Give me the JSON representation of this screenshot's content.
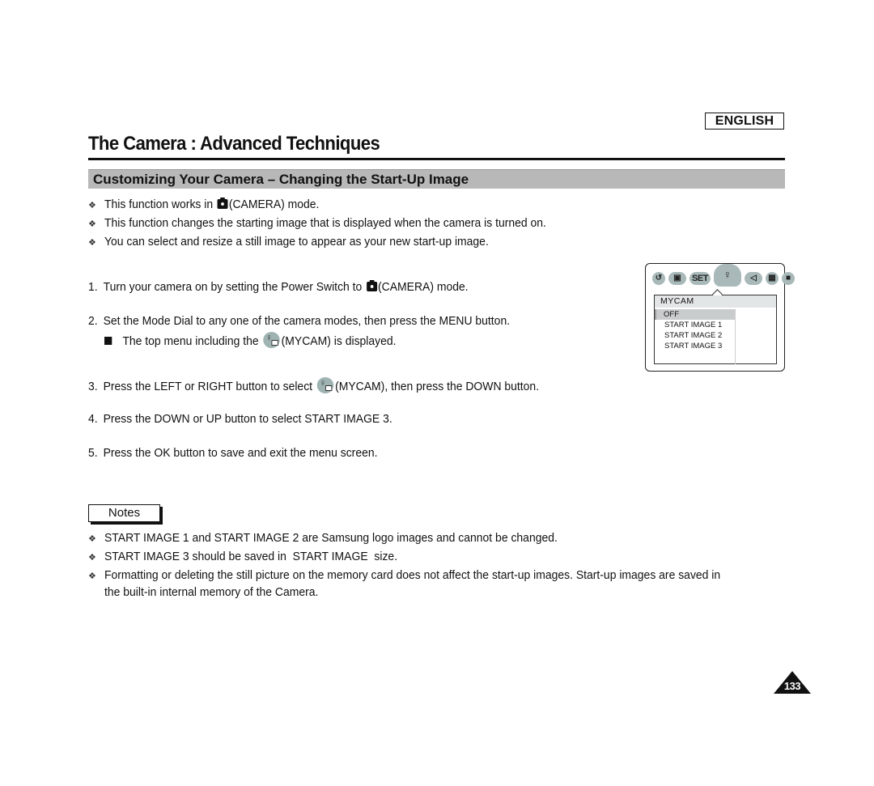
{
  "header": {
    "language": "ENGLISH",
    "title": "The Camera : Advanced Techniques",
    "section_title": "Customizing Your Camera – Changing the Start-Up Image"
  },
  "intro_bullets": [
    {
      "before": "This function works in ",
      "icon": "camera-icon",
      "after": "(CAMERA) mode."
    },
    {
      "text": "This function changes the starting image that is displayed when the camera is turned on."
    },
    {
      "text": "You can select and resize a still image to appear as your new start-up image."
    }
  ],
  "steps": [
    {
      "num": "1.",
      "before": "Turn your camera on by setting the Power Switch to ",
      "icon": "camera-icon",
      "after": "(CAMERA) mode."
    },
    {
      "num": "2.",
      "text": "Set the Mode Dial to any one of the camera modes, then press the MENU button.",
      "sub": {
        "before": "The top menu including the ",
        "icon": "mycam-icon",
        "after": "(MYCAM) is displayed."
      }
    },
    {
      "num": "3.",
      "before": "Press the LEFT or RIGHT button to select ",
      "icon": "mycam-icon",
      "after": "(MYCAM), then press the DOWN button."
    },
    {
      "num": "4.",
      "text": "Press the DOWN or UP button to select START IMAGE 3."
    },
    {
      "num": "5.",
      "text": "Press the OK button to save and exit the menu screen."
    }
  ],
  "lcd": {
    "icons": [
      "self-timer-icon",
      "effect-icon",
      "SET",
      "mycam-icon",
      "sound-icon",
      "grid-icon",
      "display-icon"
    ],
    "set_label": "SET",
    "menu_title": "MYCAM",
    "options": [
      "OFF",
      "START IMAGE 1",
      "START IMAGE 2",
      "START IMAGE 3"
    ],
    "selected": "OFF"
  },
  "notes": {
    "label": "Notes",
    "items": [
      "START IMAGE 1 and START IMAGE 2 are Samsung logo images and cannot be changed.",
      "START IMAGE 3 should be saved in  START IMAGE  size.",
      "Formatting or deleting the still picture on the memory card does not affect the start-up images. Start-up images are saved in the built-in internal memory of the Camera."
    ]
  },
  "page_number": "133",
  "bullet_glyph": "❖"
}
